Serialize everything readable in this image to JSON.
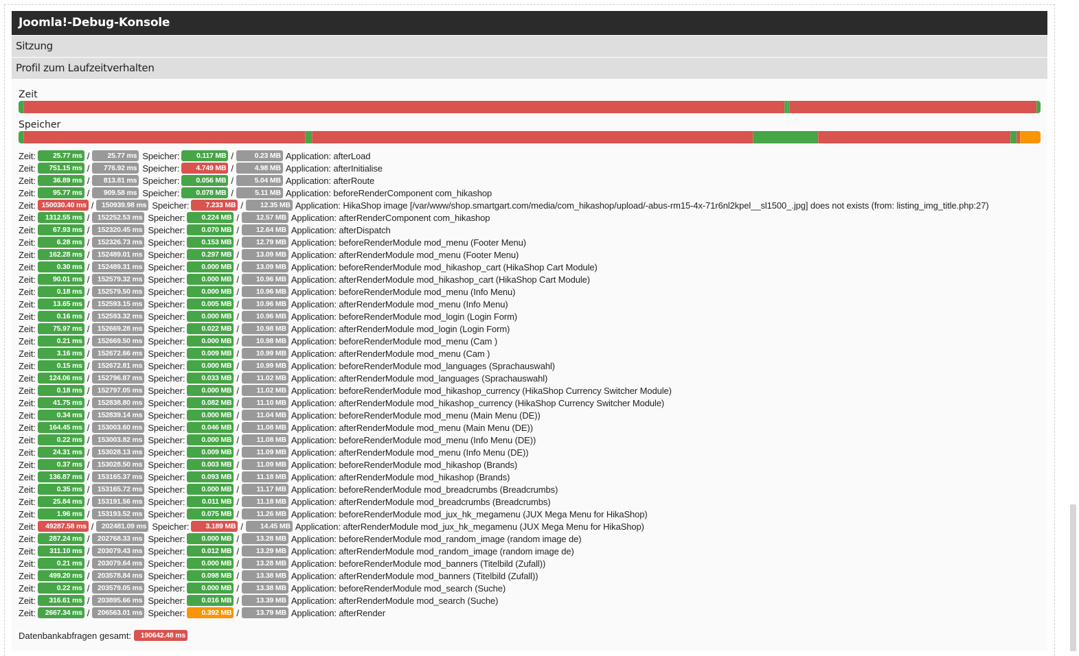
{
  "console": {
    "title": "Joomla!-Debug-Konsole",
    "sections": {
      "session": "Sitzung",
      "profile": "Profil zum Laufzeitverhalten"
    }
  },
  "labels": {
    "time_header": "Zeit",
    "memory_header": "Speicher",
    "time_row": "Zeit:",
    "memory_row": "Speicher:",
    "slash": "/"
  },
  "colors": {
    "green": "#46a546",
    "red": "#d9534f",
    "orange": "#f89406",
    "gray": "#999999"
  },
  "time_bar": [
    {
      "share": 0.0048,
      "status": "green"
    },
    {
      "share": 0.7442,
      "status": "red"
    },
    {
      "share": 0.0033,
      "status": "green"
    },
    {
      "share": 0.0015,
      "status": "green"
    },
    {
      "share": 0.2423,
      "status": "red"
    },
    {
      "share": 0.0039,
      "status": "green"
    }
  ],
  "memory_bar": [
    {
      "share": 0.0048,
      "status": "green"
    },
    {
      "share": 0.2784,
      "status": "red"
    },
    {
      "share": 0.0068,
      "status": "green"
    },
    {
      "share": 0.4355,
      "status": "red"
    },
    {
      "share": 0.065,
      "status": "green"
    },
    {
      "share": 0.1897,
      "status": "red"
    },
    {
      "share": 0.0061,
      "status": "green"
    },
    {
      "share": 0.0038,
      "status": "red"
    },
    {
      "share": 0.0202,
      "status": "orange"
    }
  ],
  "rows": [
    {
      "time": "25.77 ms",
      "time_status": "green",
      "total": "25.77 ms",
      "mem": "0.117 MB",
      "mem_status": "green",
      "mem_total": "0.23 MB",
      "message": "Application: afterLoad"
    },
    {
      "time": "751.15 ms",
      "time_status": "green",
      "total": "776.92 ms",
      "mem": "4.749 MB",
      "mem_status": "red",
      "mem_total": "4.98 MB",
      "message": "Application: afterInitialise"
    },
    {
      "time": "36.89 ms",
      "time_status": "green",
      "total": "813.81 ms",
      "mem": "0.056 MB",
      "mem_status": "green",
      "mem_total": "5.04 MB",
      "message": "Application: afterRoute"
    },
    {
      "time": "95.77 ms",
      "time_status": "green",
      "total": "909.58 ms",
      "mem": "0.078 MB",
      "mem_status": "green",
      "mem_total": "5.11 MB",
      "message": "Application: beforeRenderComponent com_hikashop"
    },
    {
      "time": "150030.40 ms",
      "time_status": "red",
      "total": "150939.98 ms",
      "mem": "7.233 MB",
      "mem_status": "red",
      "mem_total": "12.35 MB",
      "message": "Application: HikaShop image [/var/www/shop.smartgart.com/media/com_hikashop/upload/-abus-rm15-4x-71r6nl2kpel__sl1500_.jpg] does not exists (from: listing_img_title.php:27)"
    },
    {
      "time": "1312.55 ms",
      "time_status": "green",
      "total": "152252.53 ms",
      "mem": "0.224 MB",
      "mem_status": "green",
      "mem_total": "12.57 MB",
      "message": "Application: afterRenderComponent com_hikashop"
    },
    {
      "time": "67.93 ms",
      "time_status": "green",
      "total": "152320.45 ms",
      "mem": "0.070 MB",
      "mem_status": "green",
      "mem_total": "12.64 MB",
      "message": "Application: afterDispatch"
    },
    {
      "time": "6.28 ms",
      "time_status": "green",
      "total": "152326.73 ms",
      "mem": "0.153 MB",
      "mem_status": "green",
      "mem_total": "12.79 MB",
      "message": "Application: beforeRenderModule mod_menu (Footer Menu)"
    },
    {
      "time": "162.28 ms",
      "time_status": "green",
      "total": "152489.01 ms",
      "mem": "0.297 MB",
      "mem_status": "green",
      "mem_total": "13.09 MB",
      "message": "Application: afterRenderModule mod_menu (Footer Menu)"
    },
    {
      "time": "0.30 ms",
      "time_status": "green",
      "total": "152489.31 ms",
      "mem": "0.000 MB",
      "mem_status": "green",
      "mem_total": "13.09 MB",
      "message": "Application: beforeRenderModule mod_hikashop_cart (HikaShop Cart Module)"
    },
    {
      "time": "90.01 ms",
      "time_status": "green",
      "total": "152579.32 ms",
      "mem": "0.000 MB",
      "mem_status": "green",
      "mem_total": "10.96 MB",
      "message": "Application: afterRenderModule mod_hikashop_cart (HikaShop Cart Module)"
    },
    {
      "time": "0.18 ms",
      "time_status": "green",
      "total": "152579.50 ms",
      "mem": "0.000 MB",
      "mem_status": "green",
      "mem_total": "10.96 MB",
      "message": "Application: beforeRenderModule mod_menu (Info Menu)"
    },
    {
      "time": "13.65 ms",
      "time_status": "green",
      "total": "152593.15 ms",
      "mem": "0.005 MB",
      "mem_status": "green",
      "mem_total": "10.96 MB",
      "message": "Application: afterRenderModule mod_menu (Info Menu)"
    },
    {
      "time": "0.16 ms",
      "time_status": "green",
      "total": "152593.32 ms",
      "mem": "0.000 MB",
      "mem_status": "green",
      "mem_total": "10.96 MB",
      "message": "Application: beforeRenderModule mod_login (Login Form)"
    },
    {
      "time": "75.97 ms",
      "time_status": "green",
      "total": "152669.28 ms",
      "mem": "0.022 MB",
      "mem_status": "green",
      "mem_total": "10.98 MB",
      "message": "Application: afterRenderModule mod_login (Login Form)"
    },
    {
      "time": "0.21 ms",
      "time_status": "green",
      "total": "152669.50 ms",
      "mem": "0.000 MB",
      "mem_status": "green",
      "mem_total": "10.98 MB",
      "message": "Application: beforeRenderModule mod_menu (Cam )"
    },
    {
      "time": "3.16 ms",
      "time_status": "green",
      "total": "152672.66 ms",
      "mem": "0.009 MB",
      "mem_status": "green",
      "mem_total": "10.99 MB",
      "message": "Application: afterRenderModule mod_menu (Cam )"
    },
    {
      "time": "0.15 ms",
      "time_status": "green",
      "total": "152672.81 ms",
      "mem": "0.000 MB",
      "mem_status": "green",
      "mem_total": "10.99 MB",
      "message": "Application: beforeRenderModule mod_languages (Sprachauswahl)"
    },
    {
      "time": "124.06 ms",
      "time_status": "green",
      "total": "152796.87 ms",
      "mem": "0.033 MB",
      "mem_status": "green",
      "mem_total": "11.02 MB",
      "message": "Application: afterRenderModule mod_languages (Sprachauswahl)"
    },
    {
      "time": "0.18 ms",
      "time_status": "green",
      "total": "152797.05 ms",
      "mem": "0.000 MB",
      "mem_status": "green",
      "mem_total": "11.02 MB",
      "message": "Application: beforeRenderModule mod_hikashop_currency (HikaShop Currency Switcher Module)"
    },
    {
      "time": "41.75 ms",
      "time_status": "green",
      "total": "152838.80 ms",
      "mem": "0.082 MB",
      "mem_status": "green",
      "mem_total": "11.10 MB",
      "message": "Application: afterRenderModule mod_hikashop_currency (HikaShop Currency Switcher Module)"
    },
    {
      "time": "0.34 ms",
      "time_status": "green",
      "total": "152839.14 ms",
      "mem": "0.000 MB",
      "mem_status": "green",
      "mem_total": "11.04 MB",
      "message": "Application: beforeRenderModule mod_menu (Main Menu (DE))"
    },
    {
      "time": "164.45 ms",
      "time_status": "green",
      "total": "153003.60 ms",
      "mem": "0.046 MB",
      "mem_status": "green",
      "mem_total": "11.08 MB",
      "message": "Application: afterRenderModule mod_menu (Main Menu (DE))"
    },
    {
      "time": "0.22 ms",
      "time_status": "green",
      "total": "153003.82 ms",
      "mem": "0.000 MB",
      "mem_status": "green",
      "mem_total": "11.08 MB",
      "message": "Application: beforeRenderModule mod_menu (Info Menu (DE))"
    },
    {
      "time": "24.31 ms",
      "time_status": "green",
      "total": "153028.13 ms",
      "mem": "0.009 MB",
      "mem_status": "green",
      "mem_total": "11.09 MB",
      "message": "Application: afterRenderModule mod_menu (Info Menu (DE))"
    },
    {
      "time": "0.37 ms",
      "time_status": "green",
      "total": "153028.50 ms",
      "mem": "0.003 MB",
      "mem_status": "green",
      "mem_total": "11.09 MB",
      "message": "Application: beforeRenderModule mod_hikashop (Brands)"
    },
    {
      "time": "136.87 ms",
      "time_status": "green",
      "total": "153165.37 ms",
      "mem": "0.093 MB",
      "mem_status": "green",
      "mem_total": "11.18 MB",
      "message": "Application: afterRenderModule mod_hikashop (Brands)"
    },
    {
      "time": "0.35 ms",
      "time_status": "green",
      "total": "153165.72 ms",
      "mem": "0.000 MB",
      "mem_status": "green",
      "mem_total": "11.17 MB",
      "message": "Application: beforeRenderModule mod_breadcrumbs (Breadcrumbs)"
    },
    {
      "time": "25.84 ms",
      "time_status": "green",
      "total": "153191.56 ms",
      "mem": "0.011 MB",
      "mem_status": "green",
      "mem_total": "11.18 MB",
      "message": "Application: afterRenderModule mod_breadcrumbs (Breadcrumbs)"
    },
    {
      "time": "1.96 ms",
      "time_status": "green",
      "total": "153193.52 ms",
      "mem": "0.075 MB",
      "mem_status": "green",
      "mem_total": "11.26 MB",
      "message": "Application: beforeRenderModule mod_jux_hk_megamenu (JUX Mega Menu for HikaShop)"
    },
    {
      "time": "49287.58 ms",
      "time_status": "red",
      "total": "202481.09 ms",
      "mem": "3.189 MB",
      "mem_status": "red",
      "mem_total": "14.45 MB",
      "message": "Application: afterRenderModule mod_jux_hk_megamenu (JUX Mega Menu for HikaShop)"
    },
    {
      "time": "287.24 ms",
      "time_status": "green",
      "total": "202768.33 ms",
      "mem": "0.000 MB",
      "mem_status": "green",
      "mem_total": "13.28 MB",
      "message": "Application: beforeRenderModule mod_random_image (random image de)"
    },
    {
      "time": "311.10 ms",
      "time_status": "green",
      "total": "203079.43 ms",
      "mem": "0.012 MB",
      "mem_status": "green",
      "mem_total": "13.29 MB",
      "message": "Application: afterRenderModule mod_random_image (random image de)"
    },
    {
      "time": "0.21 ms",
      "time_status": "green",
      "total": "203079.64 ms",
      "mem": "0.000 MB",
      "mem_status": "green",
      "mem_total": "13.28 MB",
      "message": "Application: beforeRenderModule mod_banners (Titelbild (Zufall))"
    },
    {
      "time": "499.20 ms",
      "time_status": "green",
      "total": "203578.84 ms",
      "mem": "0.098 MB",
      "mem_status": "green",
      "mem_total": "13.38 MB",
      "message": "Application: afterRenderModule mod_banners (Titelbild (Zufall))"
    },
    {
      "time": "0.22 ms",
      "time_status": "green",
      "total": "203579.05 ms",
      "mem": "0.000 MB",
      "mem_status": "green",
      "mem_total": "13.38 MB",
      "message": "Application: beforeRenderModule mod_search (Suche)"
    },
    {
      "time": "316.61 ms",
      "time_status": "green",
      "total": "203895.66 ms",
      "mem": "0.016 MB",
      "mem_status": "green",
      "mem_total": "13.39 MB",
      "message": "Application: afterRenderModule mod_search (Suche)"
    },
    {
      "time": "2667.34 ms",
      "time_status": "green",
      "total": "206563.01 ms",
      "mem": "0.392 MB",
      "mem_status": "orange",
      "mem_total": "13.79 MB",
      "message": "Application: afterRender"
    }
  ],
  "summary": {
    "label": "Datenbankabfragen gesamt:",
    "value": "190642.48 ms",
    "status": "red"
  }
}
